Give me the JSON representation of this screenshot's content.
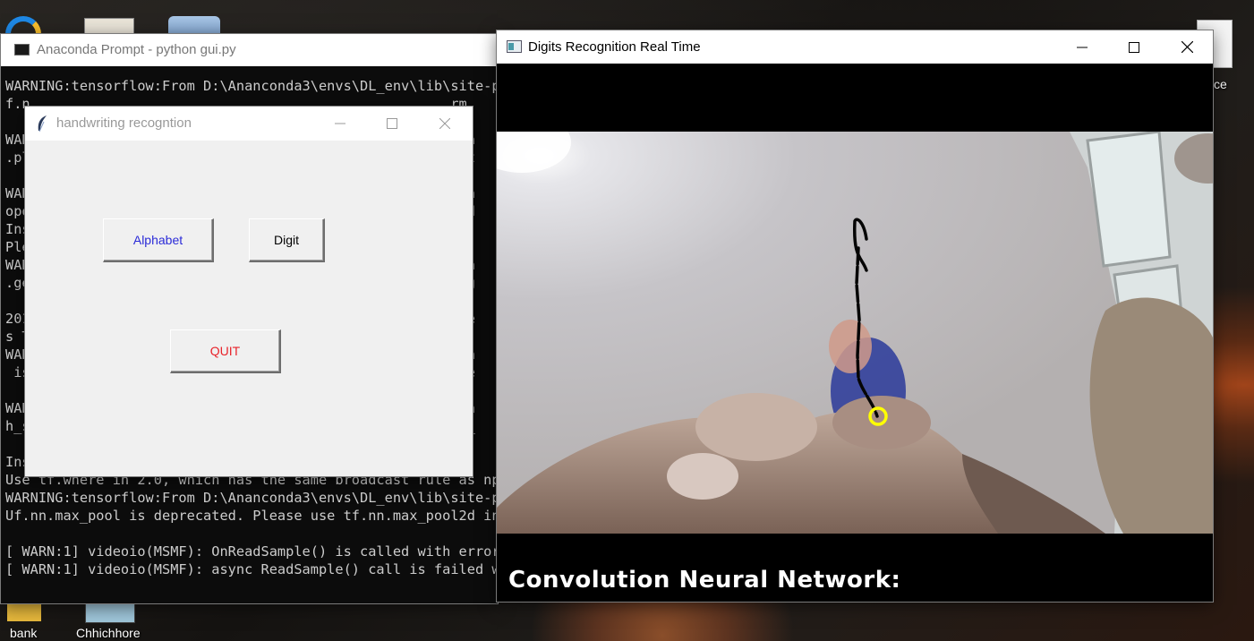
{
  "desktop": {
    "icons": [
      {
        "label": "bank"
      },
      {
        "label": "Chhichhore"
      },
      {
        "label": "ce"
      }
    ]
  },
  "terminal": {
    "title": "Anaconda Prompt - python  gui.py",
    "lines": [
      "WARNING:tensorflow:From D:\\Ananconda3\\envs\\DL_env\\lib\\site-pa",
      "f.n                                                   rm",
      "",
      "WAR                                                   -pa",
      ".pl                                                   pat",
      "",
      "WAR                                                   -pa",
      "opo                                                   s d",
      "Ins",
      "Ple                                                   et",
      "WAR                                                   -pa",
      ".ge                                                   1.g",
      "",
      "201                                                   _fe",
      "s T",
      "WAR                                                   -pa",
      " is                                                   ste",
      "",
      "WAR                                                   -pa",
      "h_s                                                   ay_",
      "",
      "Ins",
      "Use tf.where in 2.0, which has the same broadcast rule as np.",
      "WARNING:tensorflow:From D:\\Ananconda3\\envs\\DL_env\\lib\\site-pa",
      "Uf.nn.max_pool is deprecated. Please use tf.nn.max_pool2d inst",
      "",
      "[ WARN:1] videoio(MSMF): OnReadSample() is called with error",
      "[ WARN:1] videoio(MSMF): async ReadSample() call is failed wi"
    ]
  },
  "tk_window": {
    "title": "handwriting recogntion",
    "buttons": {
      "alphabet": "Alphabet",
      "digit": "Digit",
      "quit": "QUIT"
    },
    "colors": {
      "alphabet_text": "#2b2bd8",
      "digit_text": "#000000",
      "quit_text": "#e8232a"
    }
  },
  "cv_window": {
    "title": "Digits Recognition Real Time",
    "caption": "Convolution Neural Network:"
  },
  "icons": {
    "minimize": "minimize-icon",
    "maximize": "maximize-icon",
    "close": "close-icon",
    "app": "window-app-icon",
    "feather": "feather-icon"
  }
}
